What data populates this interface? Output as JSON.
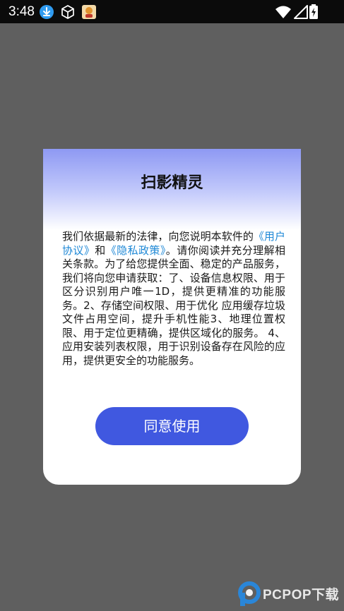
{
  "status_bar": {
    "time": "3:48",
    "left_icons": [
      "download-icon",
      "cube-icon",
      "app-notification-icon"
    ],
    "right_icons": [
      "wifi-icon",
      "signal-icon",
      "battery-charging-icon"
    ]
  },
  "dialog": {
    "title": "扫影精灵",
    "text_part1": "我们依据最新的法律，向您说明本软件的",
    "user_agreement_link": "《用户协议》",
    "text_and": "和",
    "privacy_policy_link": "《隐私政策》",
    "text_part2": "。请你阅读并充分理解相关条款。为了给您提供全面、稳定的产品服务，我们将向您申请获取：了、设备信息权限、用于区分识别用户唯一1D，提供更精准的功能服务。2、存储空间权限、用于优化 应用缓存垃圾文件占用空间，提升手机性能3、地理位置权限、用于定位更精确，提供区域化的服务。 4、应用安装列表权限，用于识别设备存在风险的应用，提供更安全的功能服务。",
    "agree_button": "同意使用"
  },
  "watermark": {
    "text": "PCPOP下载"
  },
  "colors": {
    "accent": "#4058e0",
    "link": "#1e88d6",
    "header_gradient": "#8e99f3",
    "overlay": "#5f5f5f"
  }
}
